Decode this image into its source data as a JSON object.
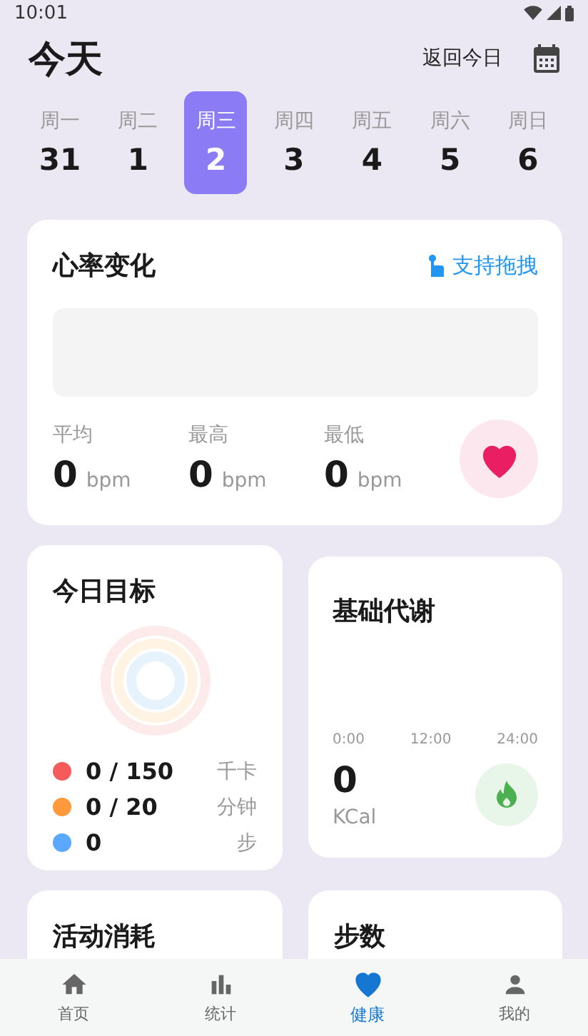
{
  "status_bar": {
    "time": "10:01"
  },
  "header": {
    "title": "今天",
    "today_button": "返回今日"
  },
  "week": [
    {
      "weekday": "周一",
      "date": "31",
      "selected": false
    },
    {
      "weekday": "周二",
      "date": "1",
      "selected": false
    },
    {
      "weekday": "周三",
      "date": "2",
      "selected": true
    },
    {
      "weekday": "周四",
      "date": "3",
      "selected": false
    },
    {
      "weekday": "周五",
      "date": "4",
      "selected": false
    },
    {
      "weekday": "周六",
      "date": "5",
      "selected": false
    },
    {
      "weekday": "周日",
      "date": "6",
      "selected": false
    }
  ],
  "heart_rate": {
    "title": "心率变化",
    "drag_hint": "支持拖拽",
    "stats": [
      {
        "label": "平均",
        "value": "0",
        "unit": "bpm"
      },
      {
        "label": "最高",
        "value": "0",
        "unit": "bpm"
      },
      {
        "label": "最低",
        "value": "0",
        "unit": "bpm"
      }
    ]
  },
  "goals": {
    "title": "今日目标",
    "items": [
      {
        "value": "0 / 150",
        "unit": "千卡",
        "color": "#f65a5a"
      },
      {
        "value": "0 / 20",
        "unit": "分钟",
        "color": "#ff9a3c"
      },
      {
        "value": "0",
        "unit": "步",
        "color": "#5aa8ff"
      }
    ]
  },
  "bmr": {
    "title": "基础代谢",
    "axis": [
      "0:00",
      "12:00",
      "24:00"
    ],
    "value": "0",
    "unit": "KCal"
  },
  "more_cards": [
    {
      "title": "活动消耗"
    },
    {
      "title": "步数"
    }
  ],
  "nav": [
    {
      "label": "首页",
      "kind": "home",
      "selected": false
    },
    {
      "label": "统计",
      "kind": "stats",
      "selected": false
    },
    {
      "label": "健康",
      "kind": "health",
      "selected": true
    },
    {
      "label": "我的",
      "kind": "me",
      "selected": false
    }
  ]
}
